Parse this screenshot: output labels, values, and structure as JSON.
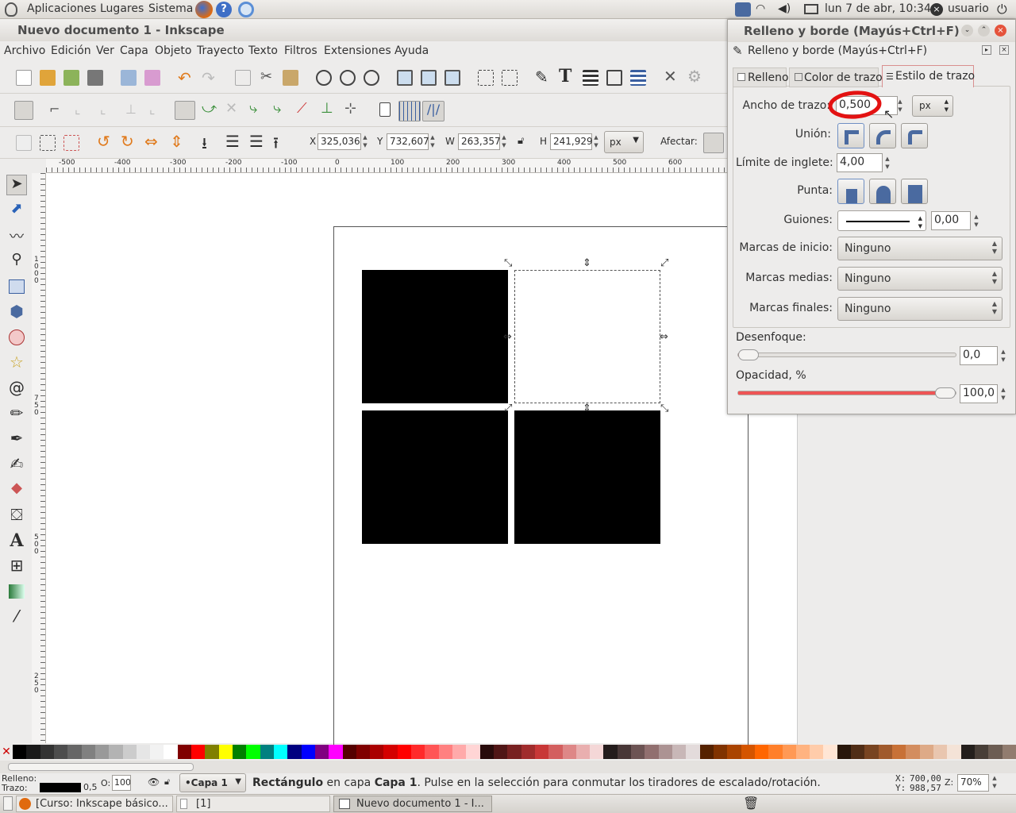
{
  "top_panel": {
    "apps": "Aplicaciones",
    "places": "Lugares",
    "system": "Sistema",
    "clock": "lun  7 de abr, 10:34",
    "user": "usuario"
  },
  "window": {
    "title": "Nuevo documento 1 - Inkscape"
  },
  "menubar": [
    "Archivo",
    "Edición",
    "Ver",
    "Capa",
    "Objeto",
    "Trayecto",
    "Texto",
    "Filtros",
    "Extensiones",
    "Ayuda"
  ],
  "select_toolbar": {
    "x_label": "X",
    "x": "325,036",
    "y_label": "Y",
    "y": "732,607",
    "w_label": "W",
    "w": "263,357",
    "h_label": "H",
    "h": "241,929",
    "unit": "px",
    "affect": "Afectar:"
  },
  "ruler_h": [
    "-500",
    "-400",
    "-300",
    "-200",
    "-100",
    "0",
    "100",
    "200",
    "300",
    "400",
    "500",
    "600"
  ],
  "ruler_v": [
    "1000",
    "750",
    "500",
    "250"
  ],
  "palette": [
    "#000000",
    "#1a1a1a",
    "#333333",
    "#4d4d4d",
    "#666666",
    "#808080",
    "#999999",
    "#b3b3b3",
    "#cccccc",
    "#e6e6e6",
    "#f2f2f2",
    "#ffffff",
    "#800000",
    "#ff0000",
    "#808000",
    "#ffff00",
    "#008000",
    "#00ff00",
    "#008080",
    "#00ffff",
    "#000080",
    "#0000ff",
    "#800080",
    "#ff00ff",
    "#550000",
    "#800000",
    "#aa0000",
    "#d40000",
    "#ff0000",
    "#ff2a2a",
    "#ff5555",
    "#ff8080",
    "#ffaaaa",
    "#ffd5d5",
    "#280b0b",
    "#501616",
    "#782121",
    "#a02c2c",
    "#c83737",
    "#d35f5f",
    "#de8787",
    "#e9afaf",
    "#f4d7d7",
    "#241c1c",
    "#483737",
    "#6c5353",
    "#916f6f",
    "#ac9393",
    "#c8b7b7",
    "#e3dbdb",
    "#552200",
    "#803300",
    "#aa4400",
    "#d45500",
    "#ff6600",
    "#ff7f2a",
    "#ff9955",
    "#ffb380",
    "#ffccaa",
    "#ffe6d5",
    "#28170b",
    "#502d16",
    "#784421",
    "#a05a2c",
    "#c87137",
    "#d38d5f",
    "#deaa87",
    "#e9c6af",
    "#f4e3d7",
    "#241f1c",
    "#483e37",
    "#6c5d53",
    "#917c6f"
  ],
  "status": {
    "fill_label": "Relleno:",
    "stroke_label": "Trazo:",
    "stroke_width": "0,5",
    "opacity_label": "O:",
    "opacity": "100",
    "layer": "•Capa 1",
    "message_obj": "Rectángulo",
    "message_mid": " en capa ",
    "message_layer": "Capa 1",
    "message_end": ". Pulse en la selección para conmutar los tiradores de escalado/rotación.",
    "x_label": "X:",
    "x": "700,00",
    "y_label": "Y:",
    "y": "988,57",
    "zoom_label": "Z:",
    "zoom": "70%"
  },
  "taskbar": {
    "item1": "[Curso: Inkscape básico...",
    "item2": "[1]",
    "item3": "Nuevo documento 1 - I..."
  },
  "dialog": {
    "title": "Relleno y borde (Mayús+Ctrl+F)",
    "subtitle": "Relleno y borde (Mayús+Ctrl+F)",
    "tabs": [
      "Relleno",
      "Color de trazo",
      "Estilo de trazo"
    ],
    "width_label": "Ancho de trazo:",
    "width_value": "0,500",
    "width_unit": "px",
    "join_label": "Unión:",
    "miter_label": "Límite de inglete:",
    "miter_value": "4,00",
    "cap_label": "Punta:",
    "dash_label": "Guiones:",
    "dash_offset": "0,00",
    "start_label": "Marcas de inicio:",
    "start_value": "Ninguno",
    "mid_label": "Marcas medias:",
    "mid_value": "Ninguno",
    "end_label": "Marcas finales:",
    "end_value": "Ninguno",
    "blur_label": "Desenfoque:",
    "blur_value": "0,0",
    "blur_level": 0,
    "opacity_label": "Opacidad, %",
    "opacity_value": "100,0",
    "opacity_level": 1
  }
}
